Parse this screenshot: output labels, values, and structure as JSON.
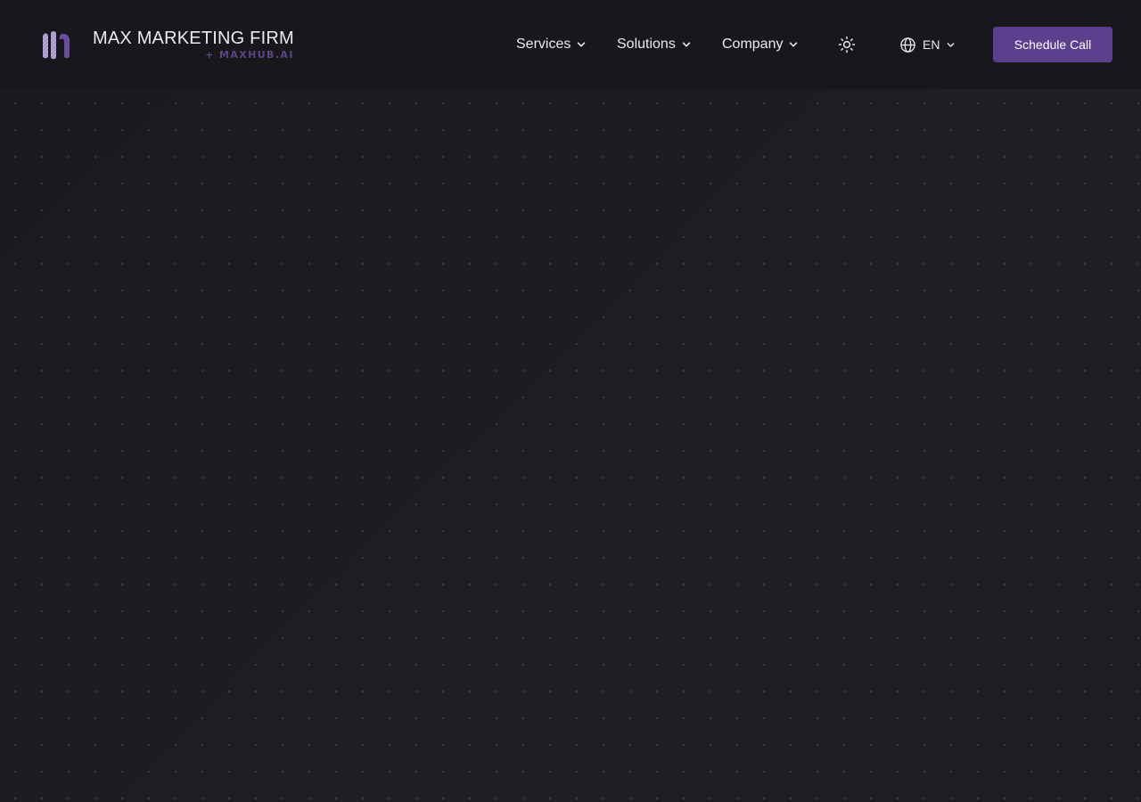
{
  "brand": {
    "name": "MAX MARKETING FIRM",
    "subtitle": "+ MAXHUB.AI",
    "logo_icon": "max-m-logo",
    "accent_color": "#5c3f8d"
  },
  "nav": {
    "items": [
      {
        "label": "Services",
        "icon": "chevron-down-icon"
      },
      {
        "label": "Solutions",
        "icon": "chevron-down-icon"
      },
      {
        "label": "Company",
        "icon": "chevron-down-icon"
      }
    ],
    "theme_toggle_icon": "sun-icon",
    "language": {
      "label": "EN",
      "icon": "globe-icon"
    },
    "cta_label": "Schedule Call"
  },
  "colors": {
    "background": "#1a191e",
    "navbar": "#18171c",
    "text": "#ece8f4",
    "subtitle": "#5a4585",
    "button": "#5c3f8d"
  }
}
